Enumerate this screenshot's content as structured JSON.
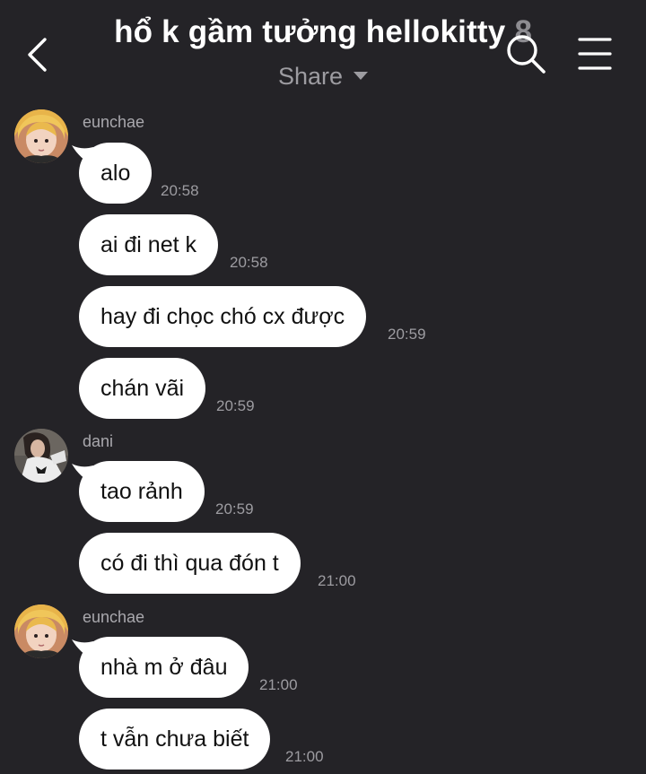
{
  "header": {
    "title": "hổ k gầm tưởng hellokitty",
    "member_count": "8",
    "share_label": "Share"
  },
  "messages": [
    {
      "sender": "eunchae",
      "text": "alo",
      "time": "20:58"
    },
    {
      "text": "ai đi net k",
      "time": "20:58"
    },
    {
      "text": "hay đi chọc chó cx được",
      "time": "20:59"
    },
    {
      "text": "chán vãi",
      "time": "20:59"
    },
    {
      "sender": "dani",
      "text": "tao rảnh",
      "time": "20:59"
    },
    {
      "text": "có đi thì qua đón t",
      "time": "21:00"
    },
    {
      "sender": "eunchae",
      "text": "nhà m ở đâu",
      "time": "21:00"
    },
    {
      "text": "t vẫn chưa biết",
      "time": "21:00"
    }
  ],
  "colors": {
    "background": "#242327",
    "bubble": "#ffffff",
    "meta_text": "#9d9ca1"
  },
  "icons": [
    "back-chevron-icon",
    "search-icon",
    "menu-icon",
    "dropdown-caret-icon"
  ]
}
